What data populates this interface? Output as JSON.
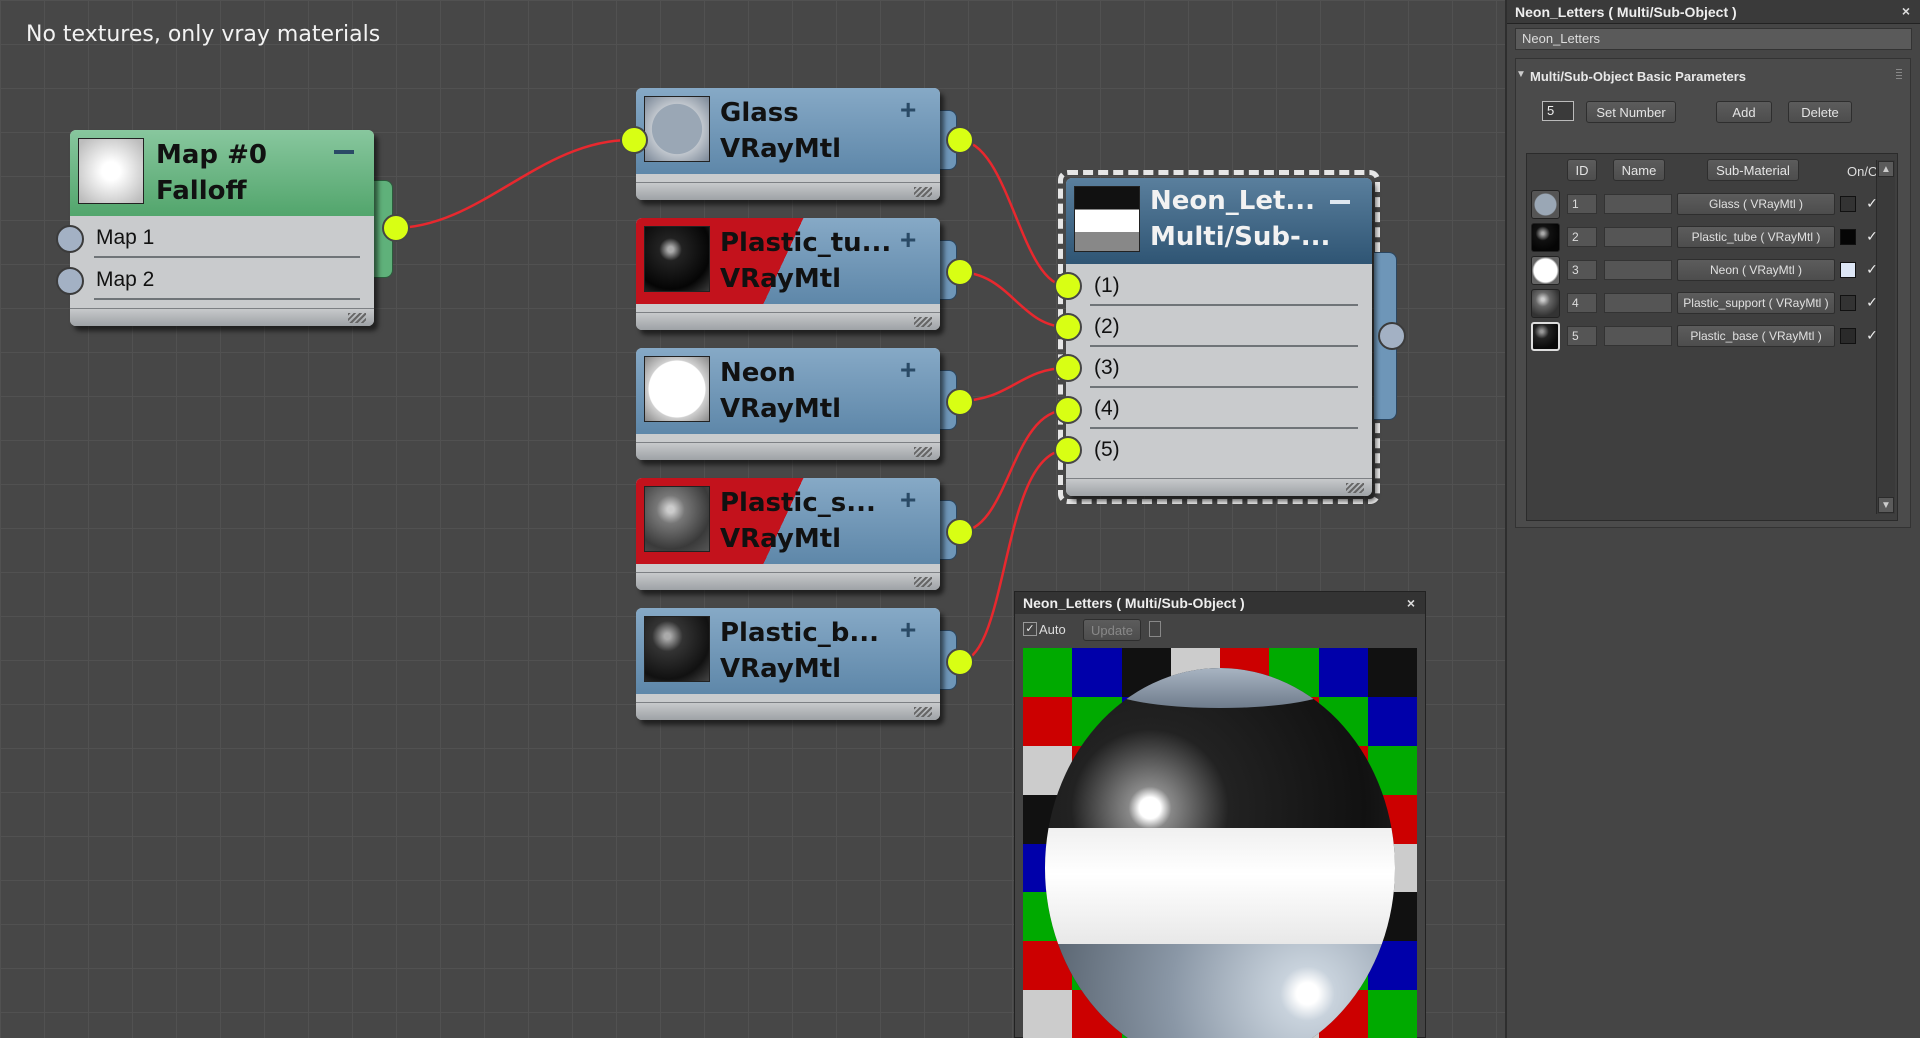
{
  "caption": "No textures, only vray materials",
  "nodes": {
    "map0": {
      "title": "Map #0",
      "subtitle": "Falloff",
      "slots": [
        "Map 1",
        "Map 2"
      ]
    },
    "glass": {
      "title": "Glass",
      "subtitle": "VRayMtl"
    },
    "plastic_tube": {
      "title": "Plastic_tu...",
      "subtitle": "VRayMtl"
    },
    "neon": {
      "title": "Neon",
      "subtitle": "VRayMtl"
    },
    "plastic_support": {
      "title": "Plastic_s...",
      "subtitle": "VRayMtl"
    },
    "plastic_base": {
      "title": "Plastic_b...",
      "subtitle": "VRayMtl"
    },
    "multi": {
      "title": "Neon_Let...",
      "subtitle": "Multi/Sub-...",
      "slots": [
        "(1)",
        "(2)",
        "(3)",
        "(4)",
        "(5)"
      ]
    }
  },
  "panel": {
    "title": "Neon_Letters  ( Multi/Sub-Object )",
    "name_value": "Neon_Letters",
    "rollout_title": "Multi/Sub-Object Basic Parameters",
    "set_number_value": "5",
    "buttons": {
      "set_number": "Set Number",
      "add": "Add",
      "delete": "Delete"
    },
    "headers": {
      "id": "ID",
      "name": "Name",
      "sub_material": "Sub-Material",
      "on_off": "On/Off"
    },
    "rows": [
      {
        "id": "1",
        "sub": "Glass  ( VRayMtl )",
        "color": "#333333"
      },
      {
        "id": "2",
        "sub": "Plastic_tube  ( VRayMtl )",
        "color": "#050505"
      },
      {
        "id": "3",
        "sub": "Neon  ( VRayMtl )",
        "color": "#dde6f5"
      },
      {
        "id": "4",
        "sub": "Plastic_support  ( VRayMtl )",
        "color": "#333333"
      },
      {
        "id": "5",
        "sub": "Plastic_base  ( VRayMtl )",
        "color": "#2a2a2a"
      }
    ]
  },
  "preview": {
    "title": "Neon_Letters  ( Multi/Sub-Object )",
    "auto_label": "Auto",
    "update_label": "Update"
  },
  "colors": {
    "wire": "#e8282e",
    "port_active": "#d8ff14",
    "node_blue": "#6e96b8",
    "node_green": "#5fb17a",
    "alert_red": "#c3121c"
  }
}
